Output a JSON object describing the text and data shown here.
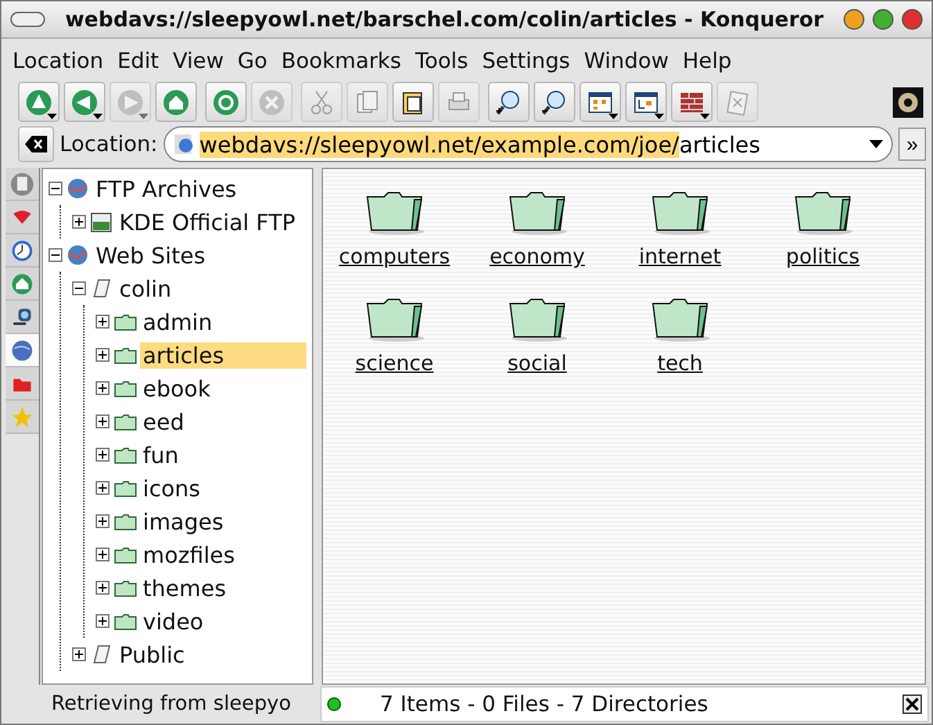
{
  "window": {
    "title": "webdavs://sleepyowl.net/barschel.com/colin/articles - Konqueror"
  },
  "menu": [
    "Location",
    "Edit",
    "View",
    "Go",
    "Bookmarks",
    "Tools",
    "Settings",
    "Window",
    "Help"
  ],
  "toolbar_groups": [
    [
      {
        "kind": "up",
        "disabled": false,
        "menu": true
      },
      {
        "kind": "back",
        "disabled": false,
        "menu": true
      },
      {
        "kind": "forward",
        "disabled": true,
        "menu": true
      },
      {
        "kind": "home",
        "disabled": false,
        "menu": false
      }
    ],
    [
      {
        "kind": "reload",
        "disabled": false,
        "menu": false
      },
      {
        "kind": "stop",
        "disabled": true,
        "menu": false
      }
    ],
    [
      {
        "kind": "cut",
        "disabled": true,
        "menu": false
      },
      {
        "kind": "copy",
        "disabled": true,
        "menu": false
      },
      {
        "kind": "paste",
        "disabled": false,
        "menu": false
      },
      {
        "kind": "print",
        "disabled": true,
        "menu": false
      }
    ],
    [
      {
        "kind": "zoom-in",
        "disabled": false,
        "menu": false
      },
      {
        "kind": "zoom-out",
        "disabled": false,
        "menu": false
      },
      {
        "kind": "icon-view",
        "disabled": false,
        "menu": true
      },
      {
        "kind": "tree-view",
        "disabled": false,
        "menu": true
      },
      {
        "kind": "firewall",
        "disabled": false,
        "menu": true
      },
      {
        "kind": "clear",
        "disabled": true,
        "menu": false
      }
    ]
  ],
  "location": {
    "label": "Location:",
    "url_selected": "webdavs://sleepyowl.net/example.com/joe/",
    "url_rest": "articles",
    "more": "»"
  },
  "sidebar_tabs": [
    {
      "kind": "config",
      "selected": false
    },
    {
      "kind": "bookmarks",
      "selected": false
    },
    {
      "kind": "history",
      "selected": false
    },
    {
      "kind": "home",
      "selected": false
    },
    {
      "kind": "services",
      "selected": false
    },
    {
      "kind": "network",
      "selected": true
    },
    {
      "kind": "folder",
      "selected": false
    },
    {
      "kind": "star",
      "selected": false
    }
  ],
  "tree": [
    {
      "label": "FTP Archives",
      "kind": "globe",
      "expanded": true,
      "selected": false,
      "children": [
        {
          "label": "KDE Official FTP",
          "kind": "ftp",
          "expanded": false,
          "selected": false
        }
      ]
    },
    {
      "label": "Web Sites",
      "kind": "globe",
      "expanded": true,
      "selected": false,
      "children": [
        {
          "label": "colin",
          "kind": "note",
          "expanded": true,
          "selected": false,
          "children": [
            {
              "label": "admin",
              "kind": "folder",
              "expanded": false,
              "selected": false
            },
            {
              "label": "articles",
              "kind": "folder",
              "expanded": false,
              "selected": true
            },
            {
              "label": "ebook",
              "kind": "folder",
              "expanded": false,
              "selected": false
            },
            {
              "label": "eed",
              "kind": "folder",
              "expanded": false,
              "selected": false
            },
            {
              "label": "fun",
              "kind": "folder",
              "expanded": false,
              "selected": false
            },
            {
              "label": "icons",
              "kind": "folder",
              "expanded": false,
              "selected": false
            },
            {
              "label": "images",
              "kind": "folder",
              "expanded": false,
              "selected": false
            },
            {
              "label": "mozfiles",
              "kind": "folder",
              "expanded": false,
              "selected": false
            },
            {
              "label": "themes",
              "kind": "folder",
              "expanded": false,
              "selected": false
            },
            {
              "label": "video",
              "kind": "folder",
              "expanded": false,
              "selected": false
            }
          ]
        },
        {
          "label": "Public",
          "kind": "note",
          "expanded": false,
          "selected": false
        }
      ]
    }
  ],
  "folders": [
    "computers",
    "economy",
    "internet",
    "politics",
    "science",
    "social",
    "tech"
  ],
  "status_bar": {
    "left": "Retrieving from sleepyo",
    "right": "7 Items - 0 Files - 7 Directories"
  }
}
